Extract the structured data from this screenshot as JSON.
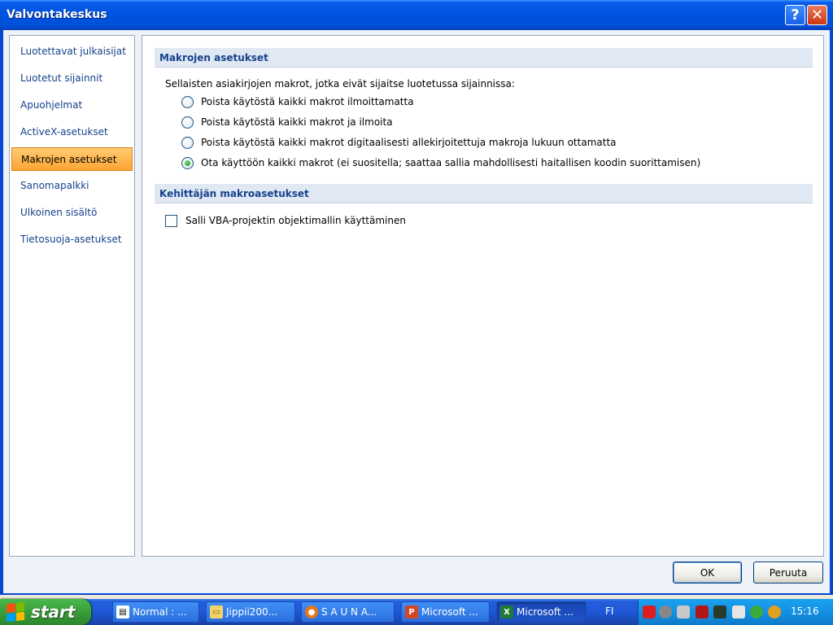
{
  "window": {
    "title": "Valvontakeskus",
    "help_glyph": "?",
    "close_glyph": "✕"
  },
  "nav": {
    "items": [
      {
        "label": "Luotettavat julkaisijat",
        "selected": false
      },
      {
        "label": "Luotetut sijainnit",
        "selected": false
      },
      {
        "label": "Apuohjelmat",
        "selected": false
      },
      {
        "label": "ActiveX-asetukset",
        "selected": false
      },
      {
        "label": "Makrojen asetukset",
        "selected": true
      },
      {
        "label": "Sanomapalkki",
        "selected": false
      },
      {
        "label": "Ulkoinen sisältö",
        "selected": false
      },
      {
        "label": "Tietosuoja-asetukset",
        "selected": false
      }
    ]
  },
  "content": {
    "macro_section_title": "Makrojen asetukset",
    "macro_intro": "Sellaisten asiakirjojen makrot, jotka eivät sijaitse luotetussa sijainnissa:",
    "macro_options": [
      {
        "label": "Poista käytöstä kaikki makrot ilmoittamatta",
        "selected": false
      },
      {
        "label": "Poista käytöstä kaikki makrot ja ilmoita",
        "selected": false
      },
      {
        "label": "Poista käytöstä kaikki makrot digitaalisesti allekirjoitettuja makroja lukuun ottamatta",
        "selected": false
      },
      {
        "label": "Ota käyttöön kaikki makrot (ei suositella; saattaa sallia mahdollisesti haitallisen koodin suorittamisen)",
        "selected": true
      }
    ],
    "developer_section_title": "Kehittäjän makroasetukset",
    "vba_checkbox": {
      "label": "Salli VBA-projektin objektimallin käyttäminen",
      "checked": false
    }
  },
  "buttons": {
    "ok": "OK",
    "cancel": "Peruuta"
  },
  "taskbar": {
    "start_label": "start",
    "tasks": [
      {
        "label": "Normal : ...",
        "icon": "document-icon",
        "active": false
      },
      {
        "label": "Jippii200...",
        "icon": "folder-icon",
        "active": false
      },
      {
        "label": "S A U N A...",
        "icon": "firefox-icon",
        "active": false
      },
      {
        "label": "Microsoft ...",
        "icon": "powerpoint-icon",
        "active": false
      },
      {
        "label": "Microsoft ...",
        "icon": "excel-icon",
        "active": true
      }
    ],
    "language": "FI",
    "clock": "15:16",
    "tray_icons": [
      "antivirus-icon",
      "speaker-small-icon",
      "network-icon",
      "shield-icon",
      "monitor-icon",
      "volume-icon",
      "messenger-icon",
      "browser-icon"
    ]
  },
  "colors": {
    "title_bar": "#0053e1",
    "selected_nav": "#ffa434",
    "section_header": "#e0e8f3",
    "link_text": "#15428b",
    "start_green": "#3a9d3a"
  }
}
